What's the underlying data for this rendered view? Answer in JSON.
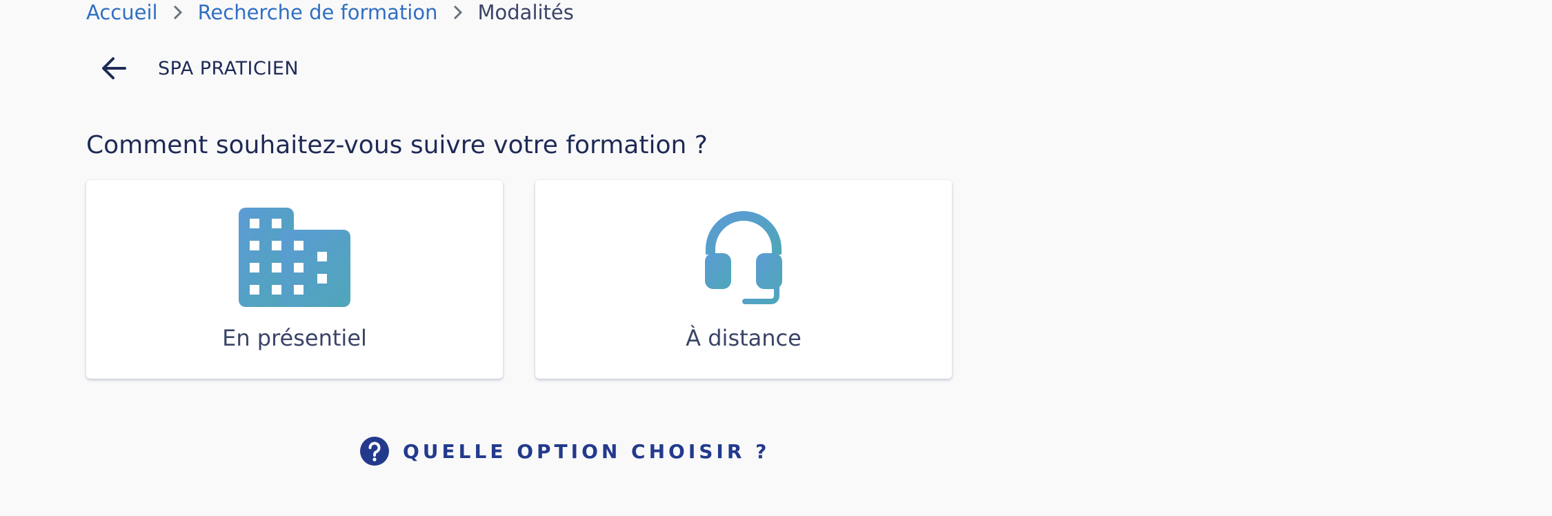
{
  "breadcrumb": {
    "items": [
      "Accueil",
      "Recherche de formation"
    ],
    "current": "Modalités"
  },
  "header": {
    "back_icon": "arrow-left-icon",
    "title": "SPA PRATICIEN"
  },
  "question": "Comment souhaitez-vous suivre votre formation ?",
  "options": [
    {
      "label": "En présentiel",
      "icon": "building-icon"
    },
    {
      "label": "À distance",
      "icon": "headset-icon"
    }
  ],
  "help": {
    "icon": "question-circle-icon",
    "label": "QUELLE OPTION CHOISIR ?"
  },
  "colors": {
    "background": "#f9f9fa",
    "link": "#2f6fc2",
    "text_dark": "#1e2a55",
    "accent": "#233a8c",
    "icon_gradient_start": "#5b9bd5",
    "icon_gradient_end": "#4fa6b8"
  }
}
